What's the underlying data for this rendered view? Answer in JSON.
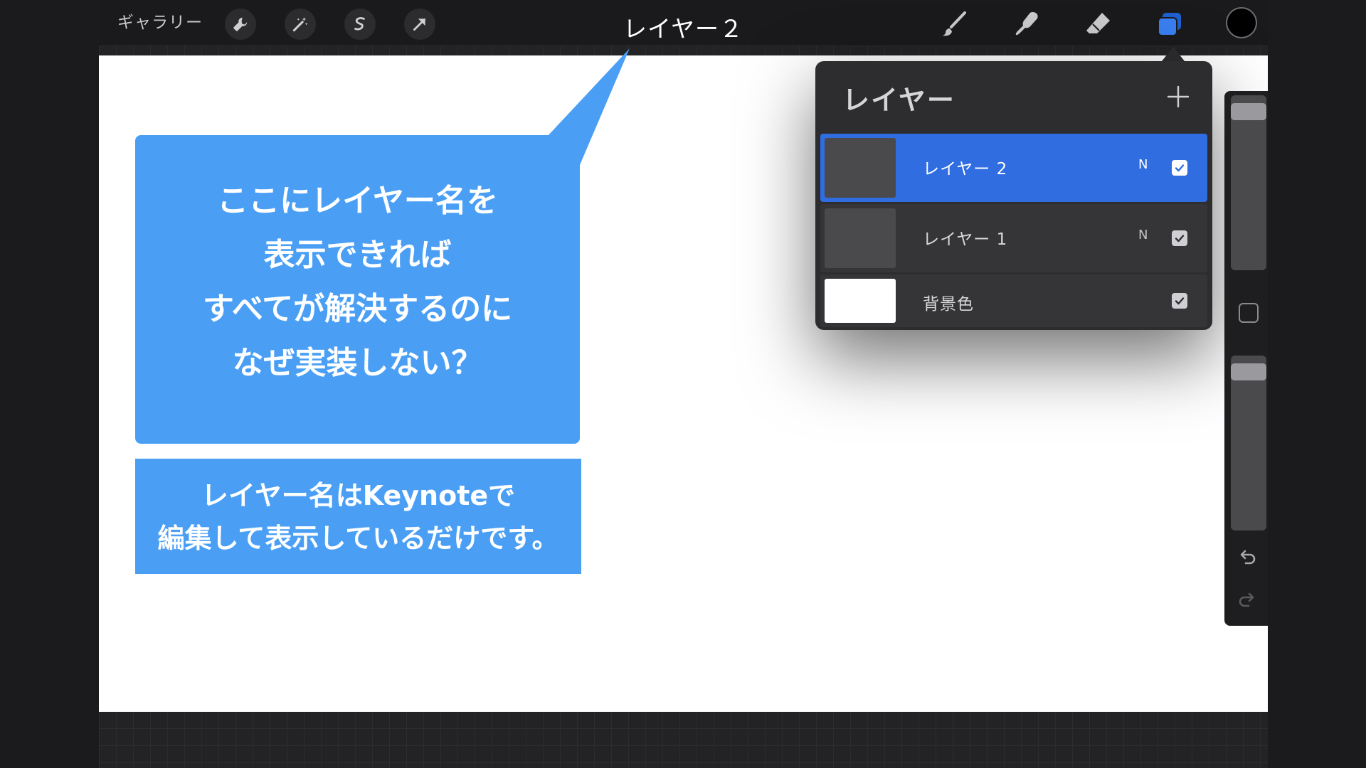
{
  "toolbar": {
    "gallery_label": "ギャラリー",
    "current_layer_title": "レイヤー２",
    "left_tools": [
      "wrench-icon",
      "magic-wand-icon",
      "selection-icon",
      "transform-arrow-icon"
    ],
    "right_tools": [
      "brush-icon",
      "smudge-icon",
      "eraser-icon",
      "layers-icon"
    ],
    "active_tool": "layers-icon",
    "accent_color": "#2f6de1",
    "current_color": "#000000"
  },
  "callout": {
    "bubble_lines": [
      "ここにレイヤー名を",
      "表示できれば",
      "すべてが解決するのに",
      "なぜ実装しない？"
    ],
    "note_lines": [
      "レイヤー名はKeynoteで",
      "編集して表示しているだけです。"
    ],
    "bubble_color": "#4a9ff5"
  },
  "layers_panel": {
    "title": "レイヤー",
    "add_label": "+",
    "layers": [
      {
        "name": "レイヤー 2",
        "blend": "N",
        "visible": true,
        "selected": true
      },
      {
        "name": "レイヤー 1",
        "blend": "N",
        "visible": true,
        "selected": false
      },
      {
        "name": "背景色",
        "blend": "",
        "visible": true,
        "selected": false
      }
    ]
  },
  "sidebar": {
    "brush_size": 0.95,
    "opacity": 0.95,
    "icons": [
      "modify-square-icon",
      "undo-icon",
      "redo-icon"
    ]
  }
}
